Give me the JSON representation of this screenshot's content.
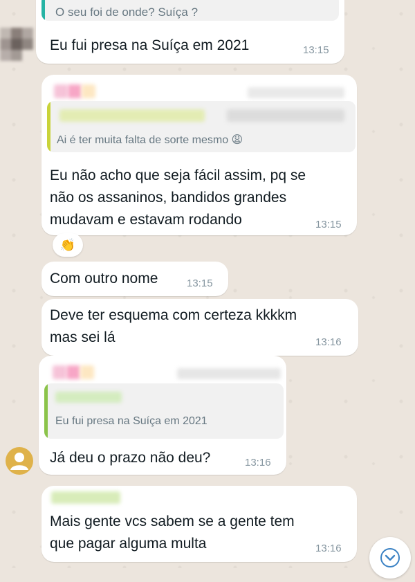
{
  "messages": [
    {
      "id": "m1",
      "quote_text": "O seu foi de onde? Suíça ?",
      "text": "Eu fui presa na Suíça em 2021",
      "time": "13:15"
    },
    {
      "id": "m2",
      "quote_text": "Ai é ter muita falta de sorte mesmo 😩",
      "text_lines": [
        "Eu não acho que seja fácil assim, pq se",
        "não os assaninos, bandidos grandes",
        "mudavam e estavam rodando"
      ],
      "time": "13:15",
      "reaction": "👏"
    },
    {
      "id": "m3",
      "text": "Com outro nome",
      "time": "13:15"
    },
    {
      "id": "m4",
      "text_lines": [
        "Deve ter esquema com certeza kkkkm",
        "mas sei lá"
      ],
      "time": "13:16"
    },
    {
      "id": "m5",
      "quote_text": "Eu fui presa na Suíça em 2021",
      "text": "Já deu o prazo não deu?",
      "time": "13:16"
    },
    {
      "id": "m6",
      "text_lines": [
        "Mais gente vcs sabem se a gente tem",
        "que pagar alguma multa"
      ],
      "time": "13:16"
    }
  ],
  "colors": {
    "bubble": "#ffffff",
    "background": "#ece5dd",
    "quote_bar_teal": "#25b3a4",
    "quote_bar_yellow": "#c9d33a",
    "quote_bar_green": "#8bc34a",
    "time": "#8696a0",
    "avatar": "#dfb24a"
  },
  "icons": {
    "scroll_down": "chevron-down-icon",
    "avatar": "user-icon"
  }
}
